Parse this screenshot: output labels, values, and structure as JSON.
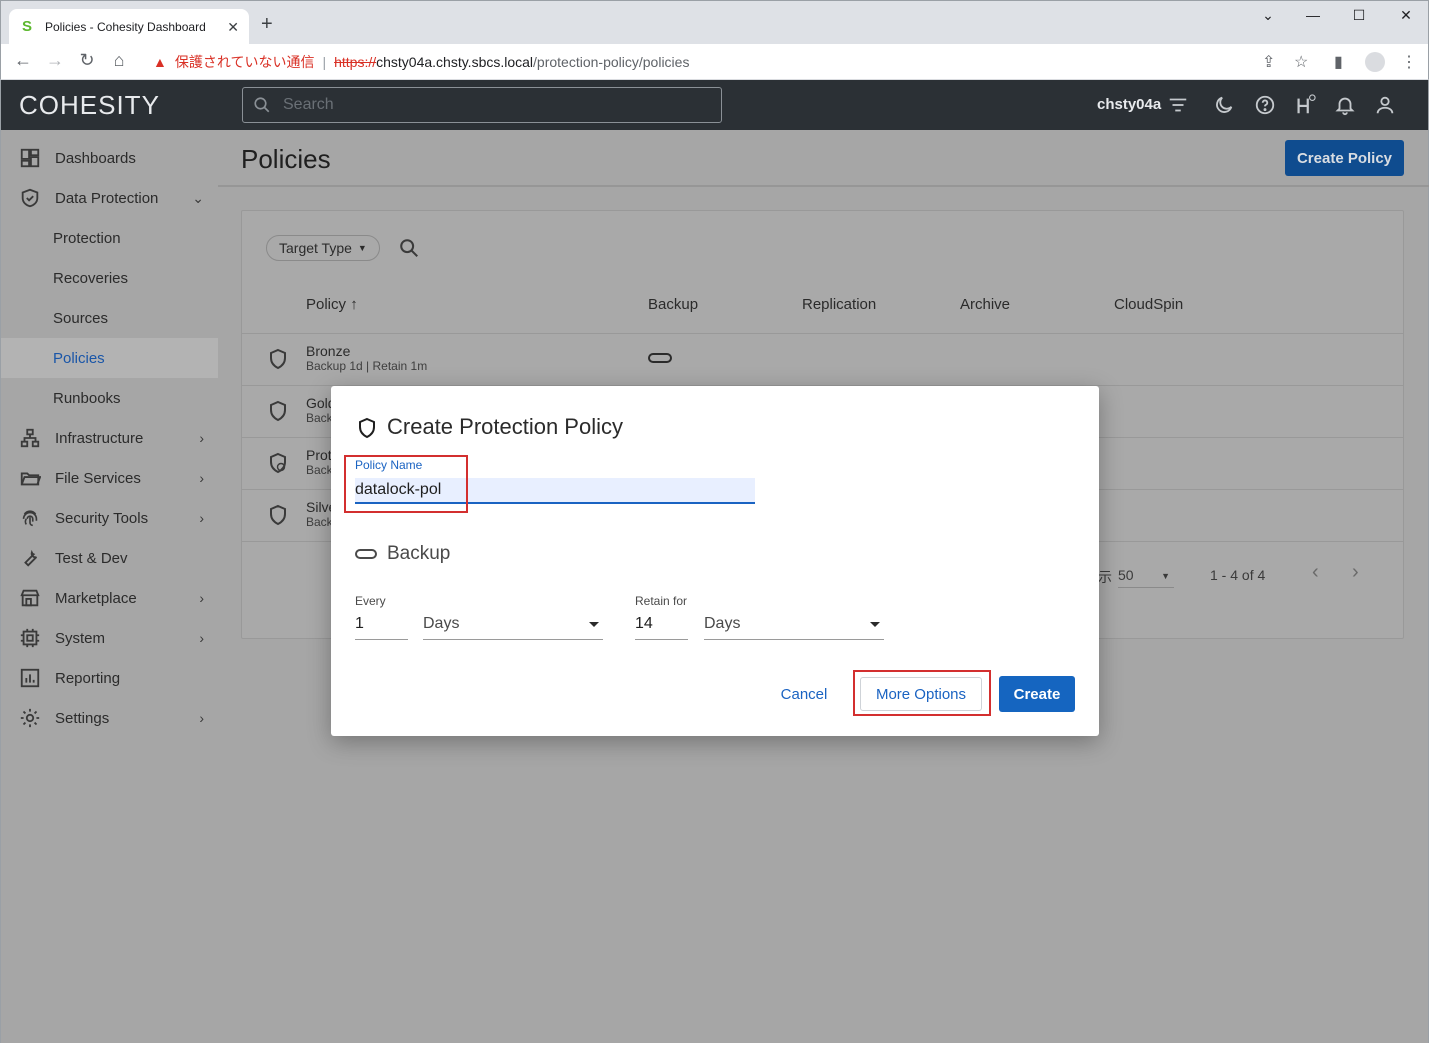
{
  "browser": {
    "tab_title": "Policies - Cohesity Dashboard",
    "insecure_label": "保護されていない通信",
    "url_scheme": "https://",
    "url_host": "chsty04a.chsty.sbcs.local",
    "url_path": "/protection-policy/policies"
  },
  "header": {
    "logo": "COHESITY",
    "search_placeholder": "Search",
    "cluster": "chsty04a"
  },
  "sidebar": {
    "items": [
      {
        "label": "Dashboards"
      },
      {
        "label": "Data Protection"
      },
      {
        "label": "Protection"
      },
      {
        "label": "Recoveries"
      },
      {
        "label": "Sources"
      },
      {
        "label": "Policies"
      },
      {
        "label": "Runbooks"
      },
      {
        "label": "Infrastructure"
      },
      {
        "label": "File Services"
      },
      {
        "label": "Security Tools"
      },
      {
        "label": "Test & Dev"
      },
      {
        "label": "Marketplace"
      },
      {
        "label": "System"
      },
      {
        "label": "Reporting"
      },
      {
        "label": "Settings"
      }
    ]
  },
  "main": {
    "title": "Policies",
    "create_button": "Create Policy",
    "filter_chip": "Target Type",
    "columns": [
      "Policy",
      "Backup",
      "Replication",
      "Archive",
      "CloudSpin"
    ],
    "sort_indicator": "↑",
    "rows": [
      {
        "name": "Bronze",
        "desc": "Backup 1d  |  Retain 1m"
      },
      {
        "name": "Gold",
        "desc": "Back"
      },
      {
        "name": "Prot",
        "desc": "Back"
      },
      {
        "name": "Silve",
        "desc": "Back"
      }
    ],
    "page_size_label": "示",
    "page_size": "50",
    "page_range": "1 - 4 of 4"
  },
  "modal": {
    "title": "Create Protection Policy",
    "policy_name_label": "Policy Name",
    "policy_name_value": "datalock-pol",
    "backup_label": "Backup",
    "every_label": "Every",
    "every_value": "1",
    "every_unit": "Days",
    "retain_label": "Retain for",
    "retain_value": "14",
    "retain_unit": "Days",
    "cancel": "Cancel",
    "more_options": "More Options",
    "create": "Create"
  }
}
